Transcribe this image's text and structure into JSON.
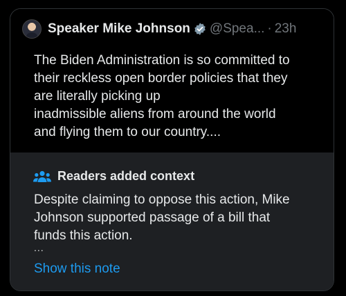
{
  "tweet": {
    "author_name": "Speaker Mike Johnson",
    "handle": "@Spea...",
    "separator": "·",
    "timestamp": "23h",
    "text_lines": [
      "The Biden Administration is so committed to",
      "their reckless open border policies that they",
      "are literally picking up",
      "inadmissible aliens from around the world",
      "and flying them to our country...."
    ]
  },
  "context": {
    "title": "Readers added context",
    "text_lines": [
      "Despite claiming to oppose this action, Mike",
      "Johnson supported passage of a bill that",
      "funds this action."
    ],
    "ellipsis": "...",
    "show_note_label": "Show this note"
  },
  "icons": {
    "verified": "verified-badge-icon",
    "readers": "people-group-icon",
    "avatar": "profile-avatar"
  },
  "colors": {
    "background": "#000000",
    "context_background": "#1e2023",
    "primary_text": "#e7e9ea",
    "secondary_text": "#71767b",
    "accent": "#1d9bf0"
  }
}
